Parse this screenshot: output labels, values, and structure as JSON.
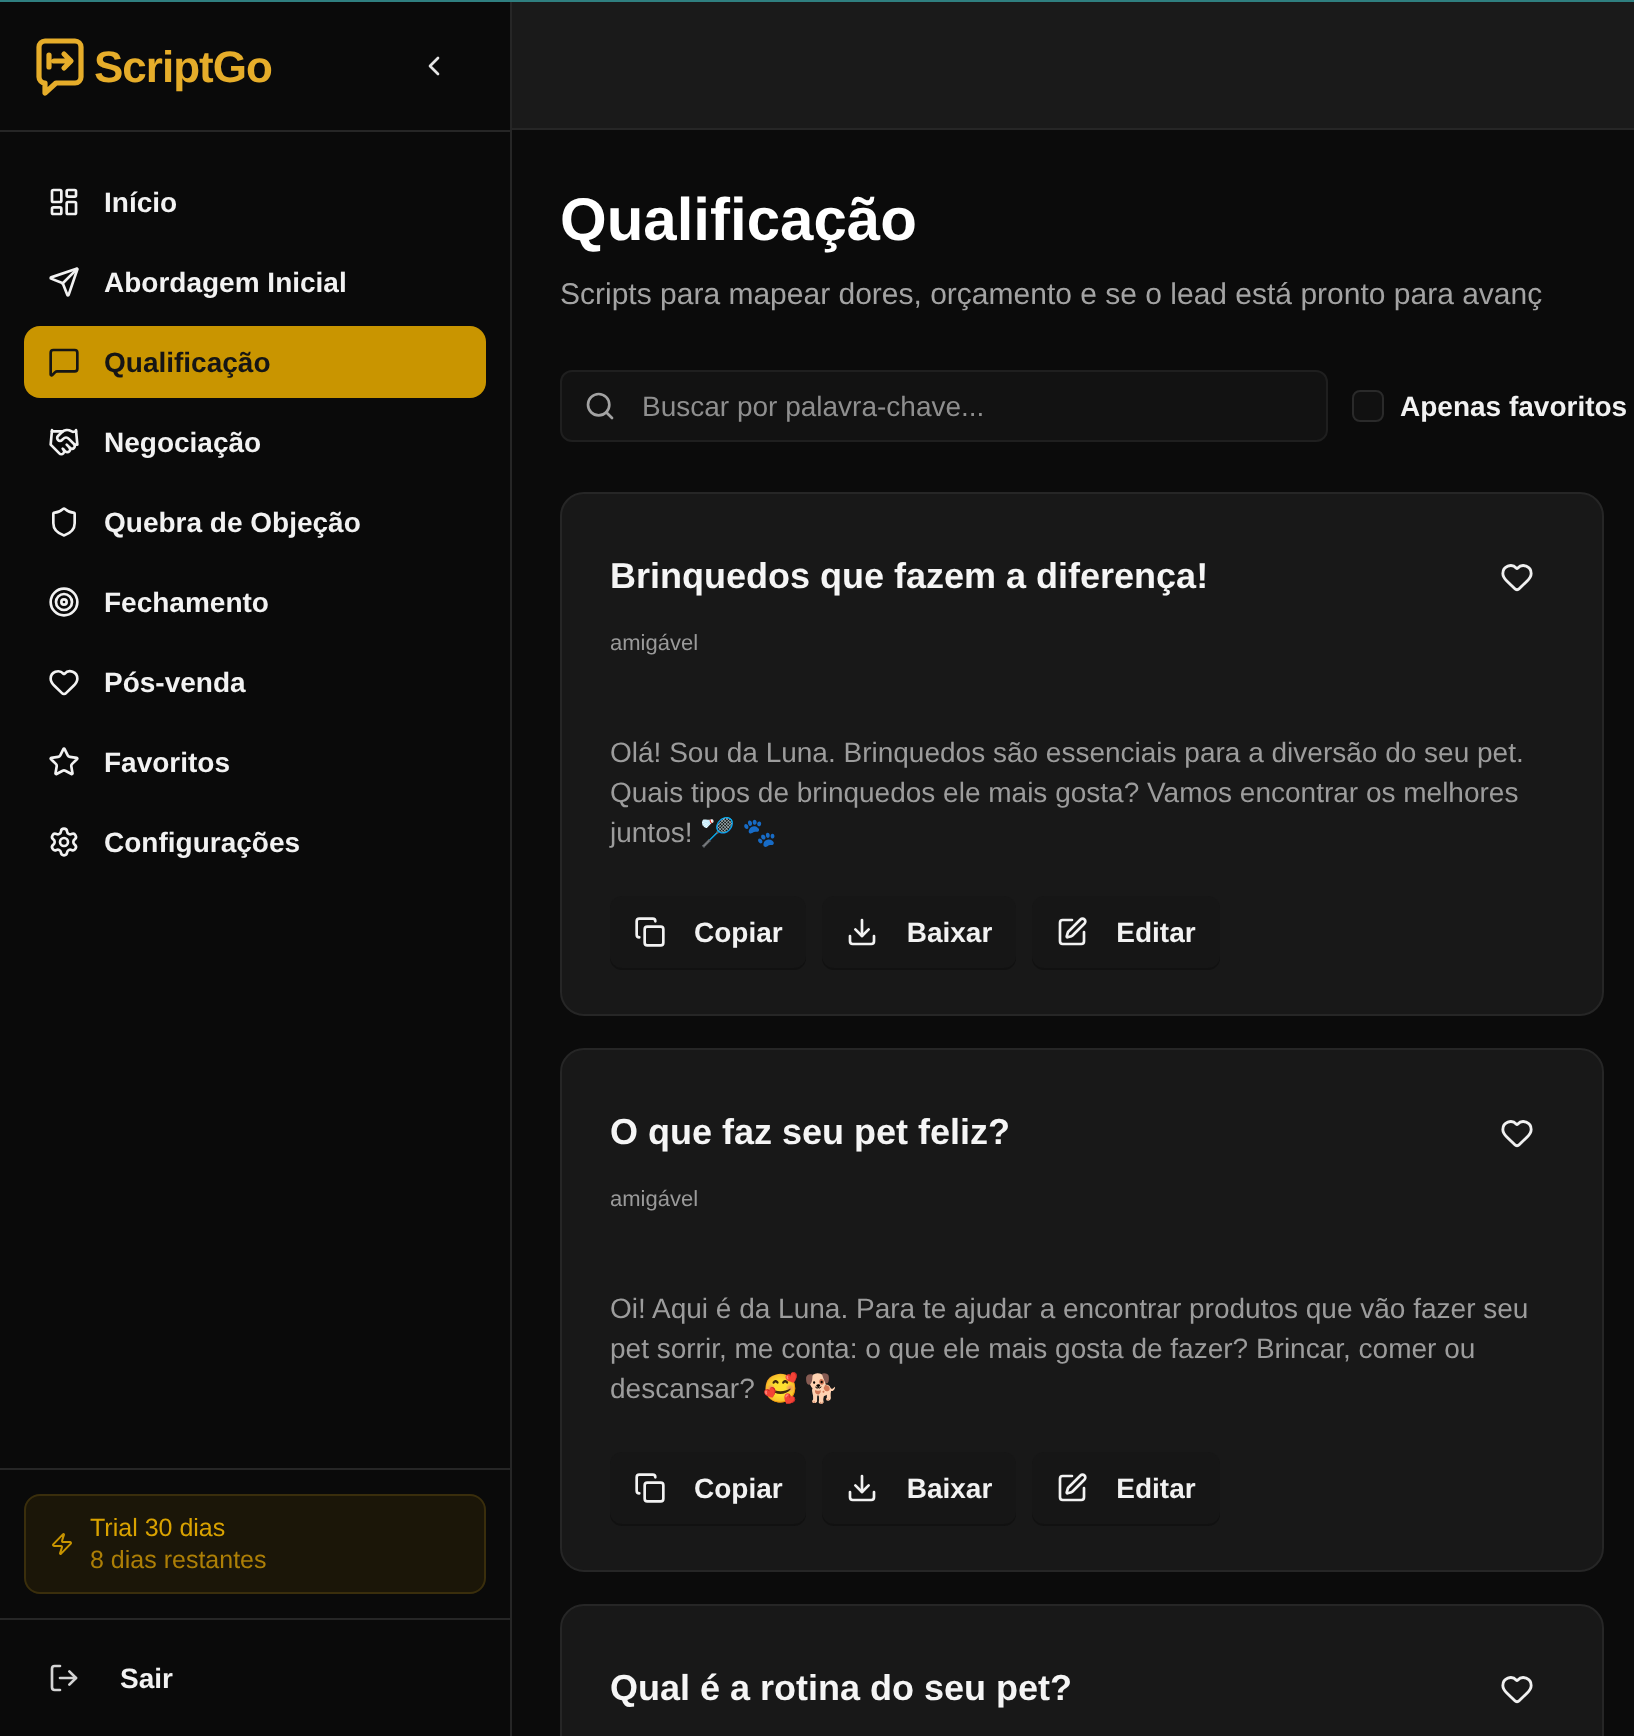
{
  "sidebar": {
    "logo": "ScriptGo",
    "items": [
      {
        "label": "Início",
        "selected": false
      },
      {
        "label": "Abordagem Inicial",
        "selected": false
      },
      {
        "label": "Qualificação",
        "selected": true
      },
      {
        "label": "Negociação",
        "selected": false
      },
      {
        "label": "Quebra de Objeção",
        "selected": false
      },
      {
        "label": "Fechamento",
        "selected": false
      },
      {
        "label": "Pós-venda",
        "selected": false
      },
      {
        "label": "Favoritos",
        "selected": false
      },
      {
        "label": "Configurações",
        "selected": false
      }
    ],
    "trial": {
      "title": "Trial 30 dias",
      "subtitle": "8 dias restantes"
    },
    "logout": "Sair"
  },
  "page": {
    "title": "Qualificação",
    "subtitle": "Scripts para mapear dores, orçamento e se o lead está pronto para avanç"
  },
  "search": {
    "placeholder": "Buscar por palavra-chave..."
  },
  "favorites_filter": {
    "label": "Apenas favoritos",
    "checked": false
  },
  "cards": [
    {
      "title": "Brinquedos que fazem a diferença!",
      "favorite": false,
      "tag": "amigável",
      "body": "Olá! Sou da Luna. Brinquedos são essenciais para a diversão do seu pet. Quais tipos de brinquedos ele mais gosta? Vamos encontrar os melhores juntos! 🏸 🐾",
      "actions": [
        "Copiar",
        "Baixar",
        "Editar"
      ]
    },
    {
      "title": "O que faz seu pet feliz?",
      "favorite": false,
      "tag": "amigável",
      "body": "Oi! Aqui é da Luna. Para te ajudar a encontrar produtos que vão fazer seu pet sorrir, me conta: o que ele mais gosta de fazer? Brincar, comer ou descansar? 🥰 🐕",
      "actions": [
        "Copiar",
        "Baixar",
        "Editar"
      ]
    },
    {
      "title": "Qual é a rotina do seu pet?",
      "favorite": false
    }
  ]
}
